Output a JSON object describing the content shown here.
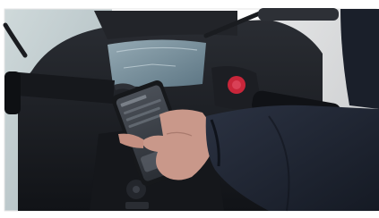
{
  "photo": {
    "subject": "photo-scene",
    "colors": {
      "background_left": "#c9d4d6",
      "background_right": "#d9dadb",
      "scooter_body": "#1b1d21",
      "dashboard_screen": "#7f99a6",
      "red_button": "#c8263a",
      "jacket": "#1f2533",
      "skin": "#c9988a",
      "phone_screen": "#3a3f47"
    }
  }
}
